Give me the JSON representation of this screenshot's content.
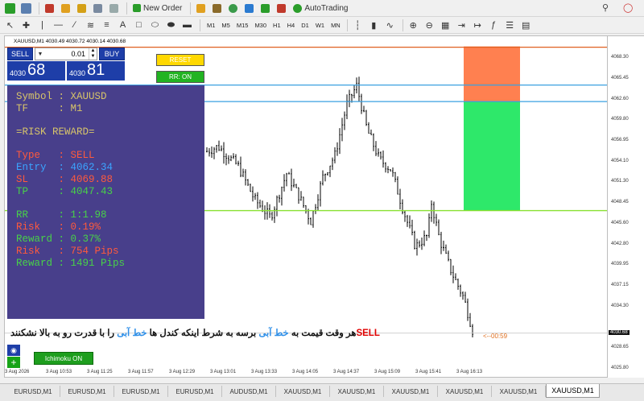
{
  "toolbar": {
    "new_order_label": "New Order",
    "autotrading_label": "AutoTrading",
    "timeframes": [
      "M1",
      "M5",
      "M15",
      "M30",
      "H1",
      "H4",
      "D1",
      "W1",
      "MN"
    ]
  },
  "chart": {
    "title": "XAUUSD,M1  4030.49 4030.72 4030.14 4030.68",
    "price_labels": [
      "4068.30",
      "4065.45",
      "4062.60",
      "4059.80",
      "4056.95",
      "4054.10",
      "4051.30",
      "4048.45",
      "4045.60",
      "4042.80",
      "4039.95",
      "4037.15",
      "4034.30",
      "4028.65",
      "4025.80"
    ],
    "current_price": "4030.68",
    "time_labels": [
      "3 Aug 2026",
      "3 Aug 10:53",
      "3 Aug 11:25",
      "3 Aug 11:57",
      "3 Aug 12:29",
      "3 Aug 13:01",
      "3 Aug 13:33",
      "3 Aug 14:05",
      "3 Aug 14:37",
      "3 Aug 15:09",
      "3 Aug 15:41",
      "3 Aug 16:13"
    ]
  },
  "trade_panel": {
    "sell_label": "SELL",
    "buy_label": "BUY",
    "lot": "0.01",
    "bid_small": "4030",
    "bid_big": "68",
    "ask_small": "4030",
    "ask_big": "81"
  },
  "buttons": {
    "reset": "RESET",
    "rr_on": "RR: ON",
    "ichimoku": "Ichimoku ON"
  },
  "info_panel": {
    "symbol": "Symbol : XAUUSD",
    "tf": "TF     : M1",
    "header": "=RISK REWARD=",
    "type": "Type   : SELL",
    "entry": "Entry  : 4062.34",
    "sl": "SL     : 4069.88",
    "tp": "TP     : 4047.43",
    "rr": "RR     : 1:1.98",
    "risk": "Risk   : 0.19%",
    "reward": "Reward : 0.37%",
    "risk_pips": "Risk   : 754 Pips",
    "reward_pips": "Reward : 1491 Pips"
  },
  "note": {
    "part_sell": "SELL",
    "part1": "هر وقت قیمت به ",
    "part_blue1": "خط آبی",
    "part2": " برسه به شرط اینکه کندل ها ",
    "part_blue2": "خط آبی",
    "part3": " را با قدرت رو به بالا نشکنند"
  },
  "timer": "<--00:59",
  "tabs": [
    "EURUSD,M1",
    "EURUSD,M1",
    "EURUSD,M1",
    "EURUSD,M1",
    "AUDUSD,M1",
    "XAUUSD,M1",
    "XAUUSD,M1",
    "XAUUSD,M1",
    "XAUUSD,M1",
    "XAUUSD,M1",
    "XAUUSD,M1"
  ],
  "colors": {
    "sl_zone": "#ff8050",
    "tp_zone": "#2ee86a",
    "entry_line": "#3aa0e0",
    "tp_line": "#88e030",
    "sl_line": "#e06020"
  }
}
